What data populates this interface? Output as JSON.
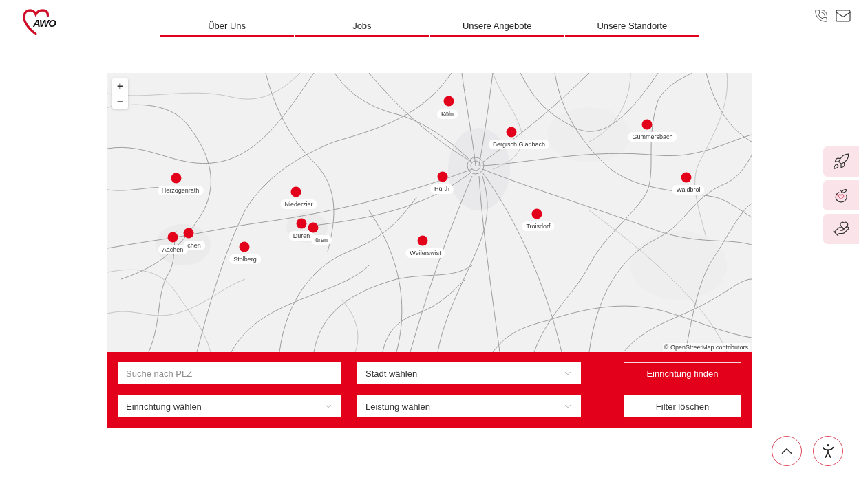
{
  "header": {
    "logo": {
      "text": "AWO"
    },
    "nav": [
      {
        "label": "Über Uns"
      },
      {
        "label": "Jobs"
      },
      {
        "label": "Unsere Angebote"
      },
      {
        "label": "Unsere Standorte"
      }
    ]
  },
  "map": {
    "zoom_controls": [
      "+",
      "−"
    ],
    "markers": [
      {
        "label": "Köln"
      },
      {
        "label": "Bergisch Gladbach"
      },
      {
        "label": "Gummersbach"
      },
      {
        "label": "Herzogenrath"
      },
      {
        "label": "Hürth"
      },
      {
        "label": "Waldbröl"
      },
      {
        "label": "Niederzier"
      },
      {
        "label": "Troisdorf"
      },
      {
        "label": "Aachen"
      },
      {
        "label": "chen"
      },
      {
        "label": "Stolberg"
      },
      {
        "label": "Düren"
      },
      {
        "label": "üren"
      },
      {
        "label": "Weilerswist"
      }
    ],
    "attribution": "© OpenStreetMap contributors"
  },
  "filter": {
    "controls": [
      {
        "kind": "input",
        "placeholder": "Suche nach PLZ"
      },
      {
        "kind": "select",
        "label": "Stadt wählen"
      },
      {
        "kind": "submit",
        "label": "Einrichtung finden"
      },
      {
        "kind": "select",
        "label": "Einrichtung wählen"
      },
      {
        "kind": "select",
        "label": "Leistung wählen"
      },
      {
        "kind": "reset",
        "label": "Filter löschen"
      }
    ]
  }
}
